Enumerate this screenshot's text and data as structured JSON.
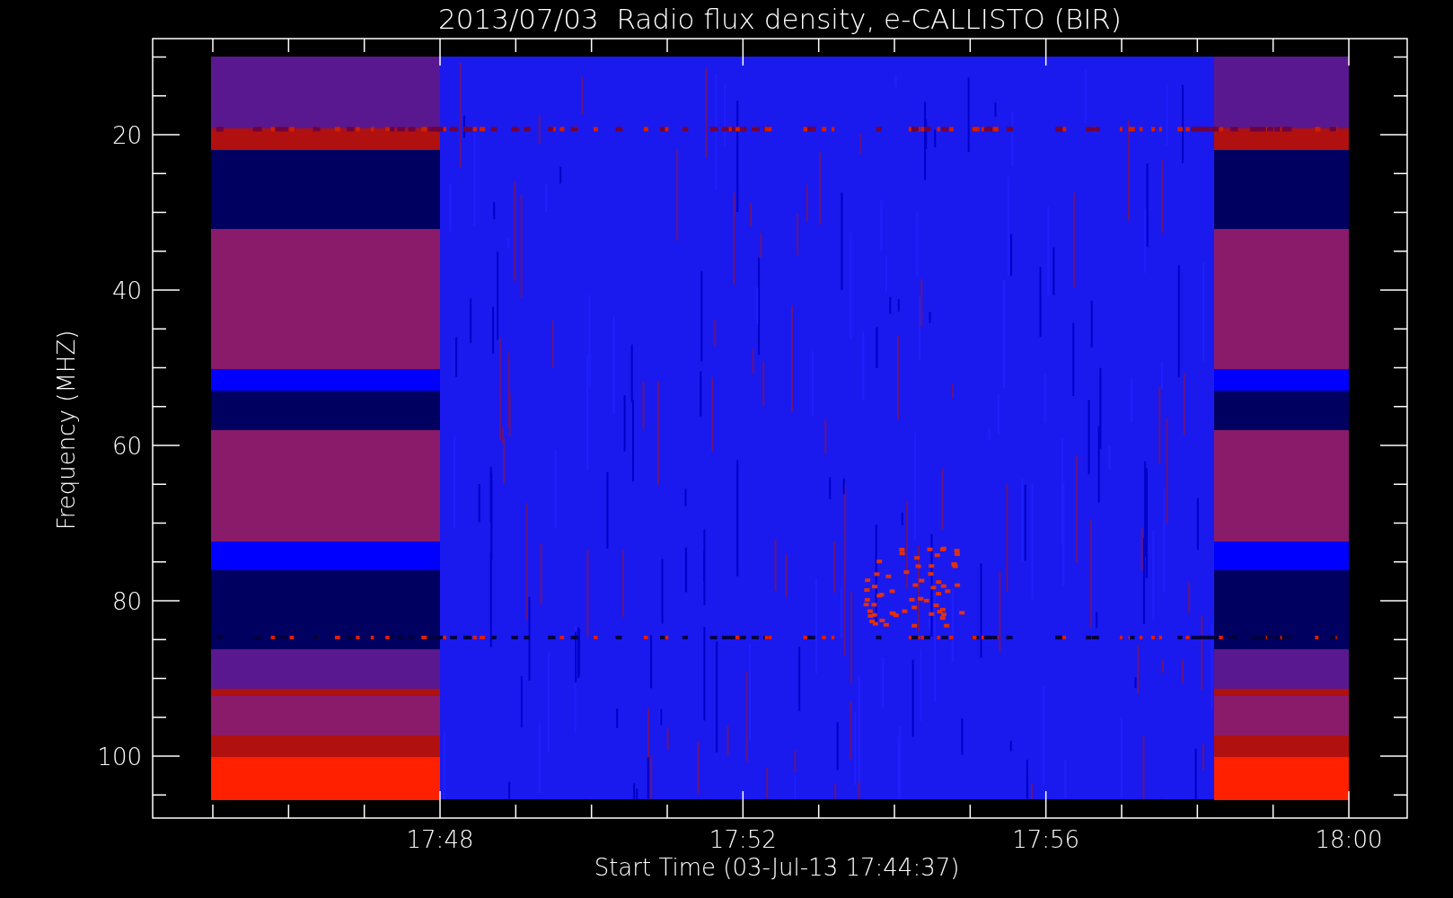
{
  "title": "2013/07/03  Radio flux density, e-CALLISTO (BIR)",
  "y_axis": {
    "label": "Frequency (MHZ)",
    "ticks": [
      "20",
      "40",
      "60",
      "80",
      "100"
    ]
  },
  "x_axis": {
    "label": "Start Time (03-Jul-13 17:44:37)",
    "ticks": [
      "17:48",
      "17:52",
      "17:56",
      "18:00"
    ]
  }
}
